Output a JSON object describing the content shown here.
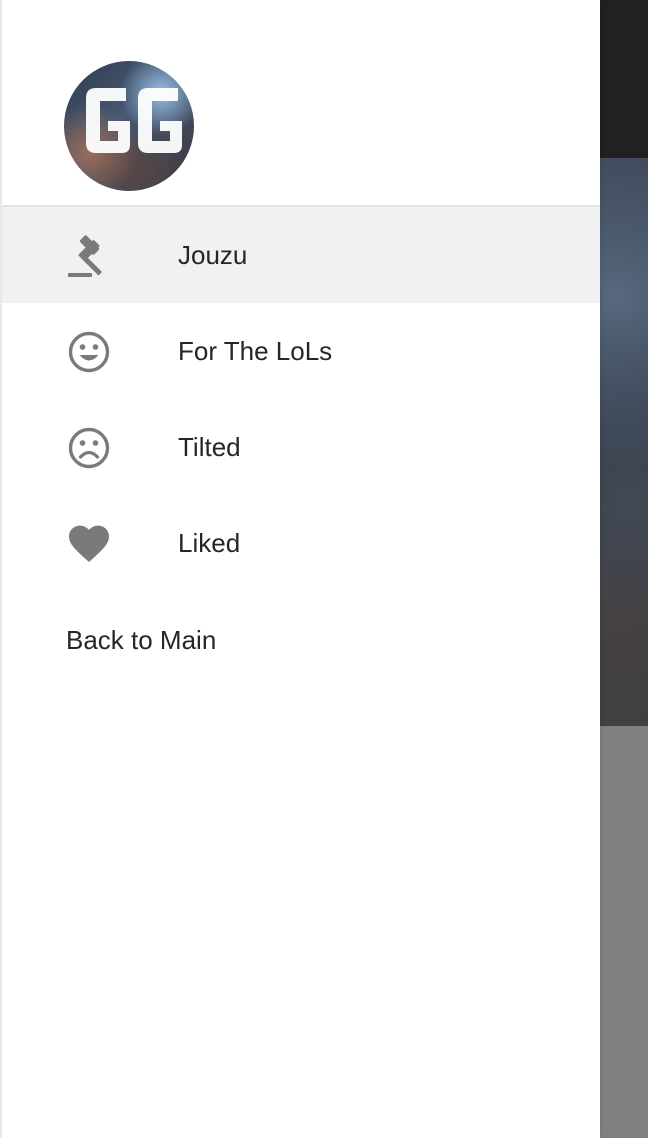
{
  "drawer": {
    "avatar_text": "GG",
    "menu": [
      {
        "label": "Jouzu",
        "icon": "gavel-icon",
        "active": true
      },
      {
        "label": "For The LoLs",
        "icon": "smiley-face-icon",
        "active": false
      },
      {
        "label": "Tilted",
        "icon": "sad-face-icon",
        "active": false
      },
      {
        "label": "Liked",
        "icon": "heart-icon",
        "active": false
      }
    ],
    "back_label": "Back to Main"
  },
  "colors": {
    "icon": "#7a7a7a",
    "active_bg": "#f1f1f1",
    "text": "#262626"
  }
}
